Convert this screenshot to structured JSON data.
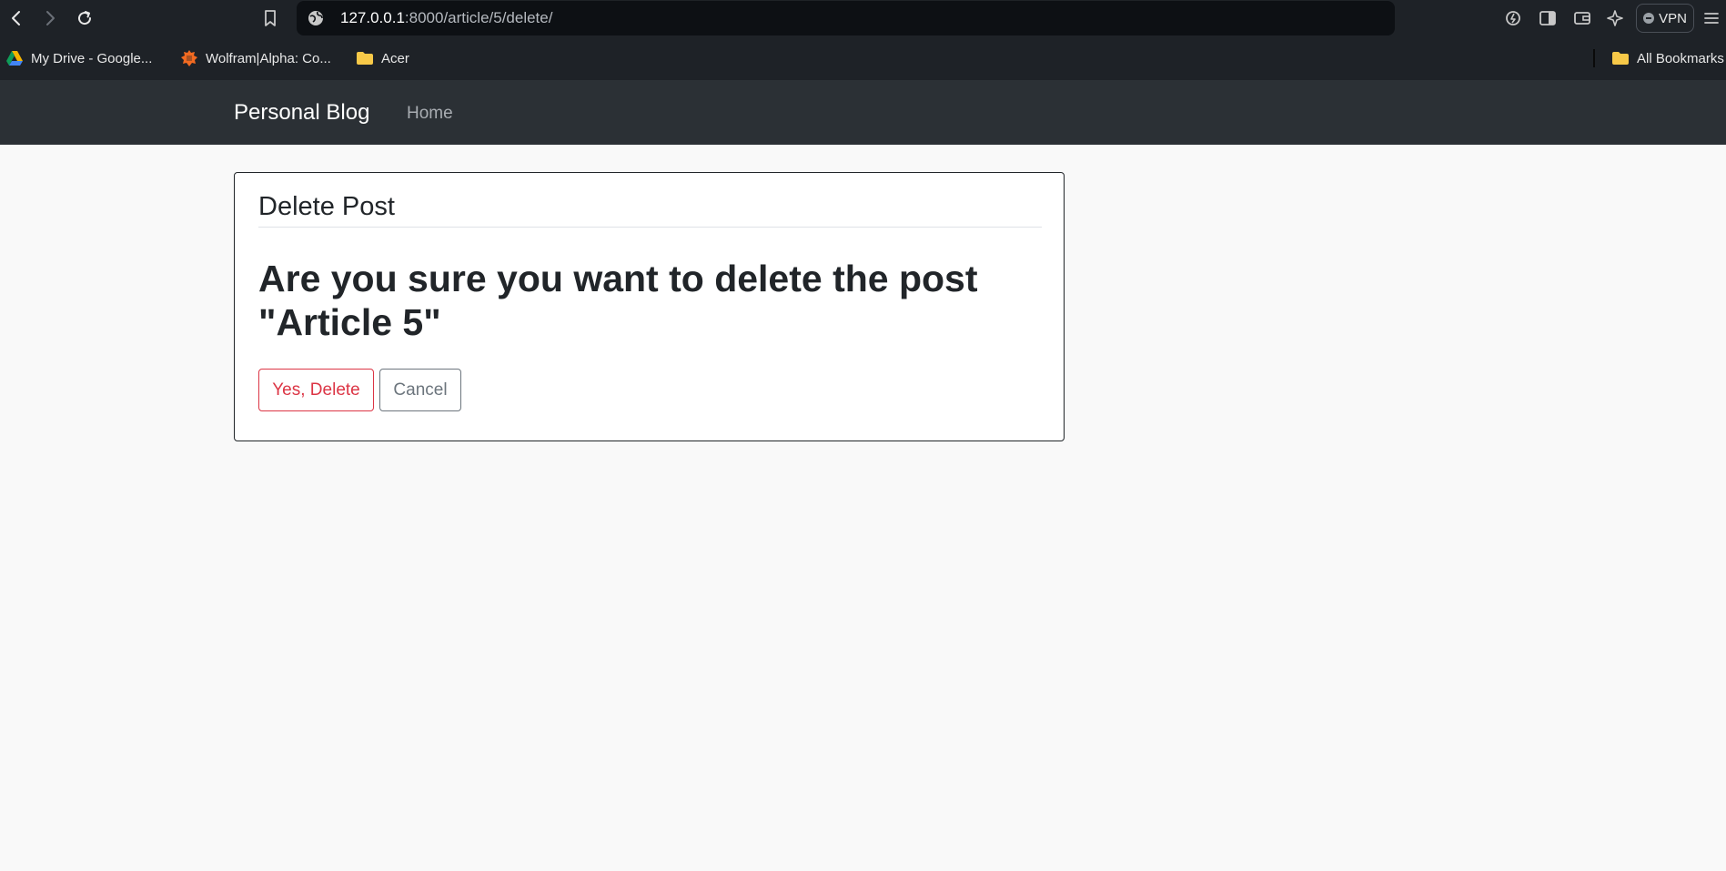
{
  "browser": {
    "url_host": "127.0.0.1",
    "url_path": ":8000/article/5/delete/",
    "vpn_label": "VPN",
    "bookmarks": [
      {
        "label": "My Drive - Google...",
        "icon": "google-drive-icon"
      },
      {
        "label": "Wolfram|Alpha: Co...",
        "icon": "wolfram-icon"
      },
      {
        "label": "Acer",
        "icon": "folder-icon"
      }
    ],
    "all_bookmarks_label": "All Bookmarks"
  },
  "site": {
    "brand": "Personal Blog",
    "nav_home": "Home"
  },
  "card": {
    "header": "Delete Post",
    "question": "Are you sure you want to delete the post \"Article 5\"",
    "confirm_label": "Yes, Delete",
    "cancel_label": "Cancel"
  },
  "colors": {
    "navbar_bg": "#2b3035",
    "danger": "#dc3545",
    "secondary": "#6c757d",
    "text": "#212529"
  }
}
